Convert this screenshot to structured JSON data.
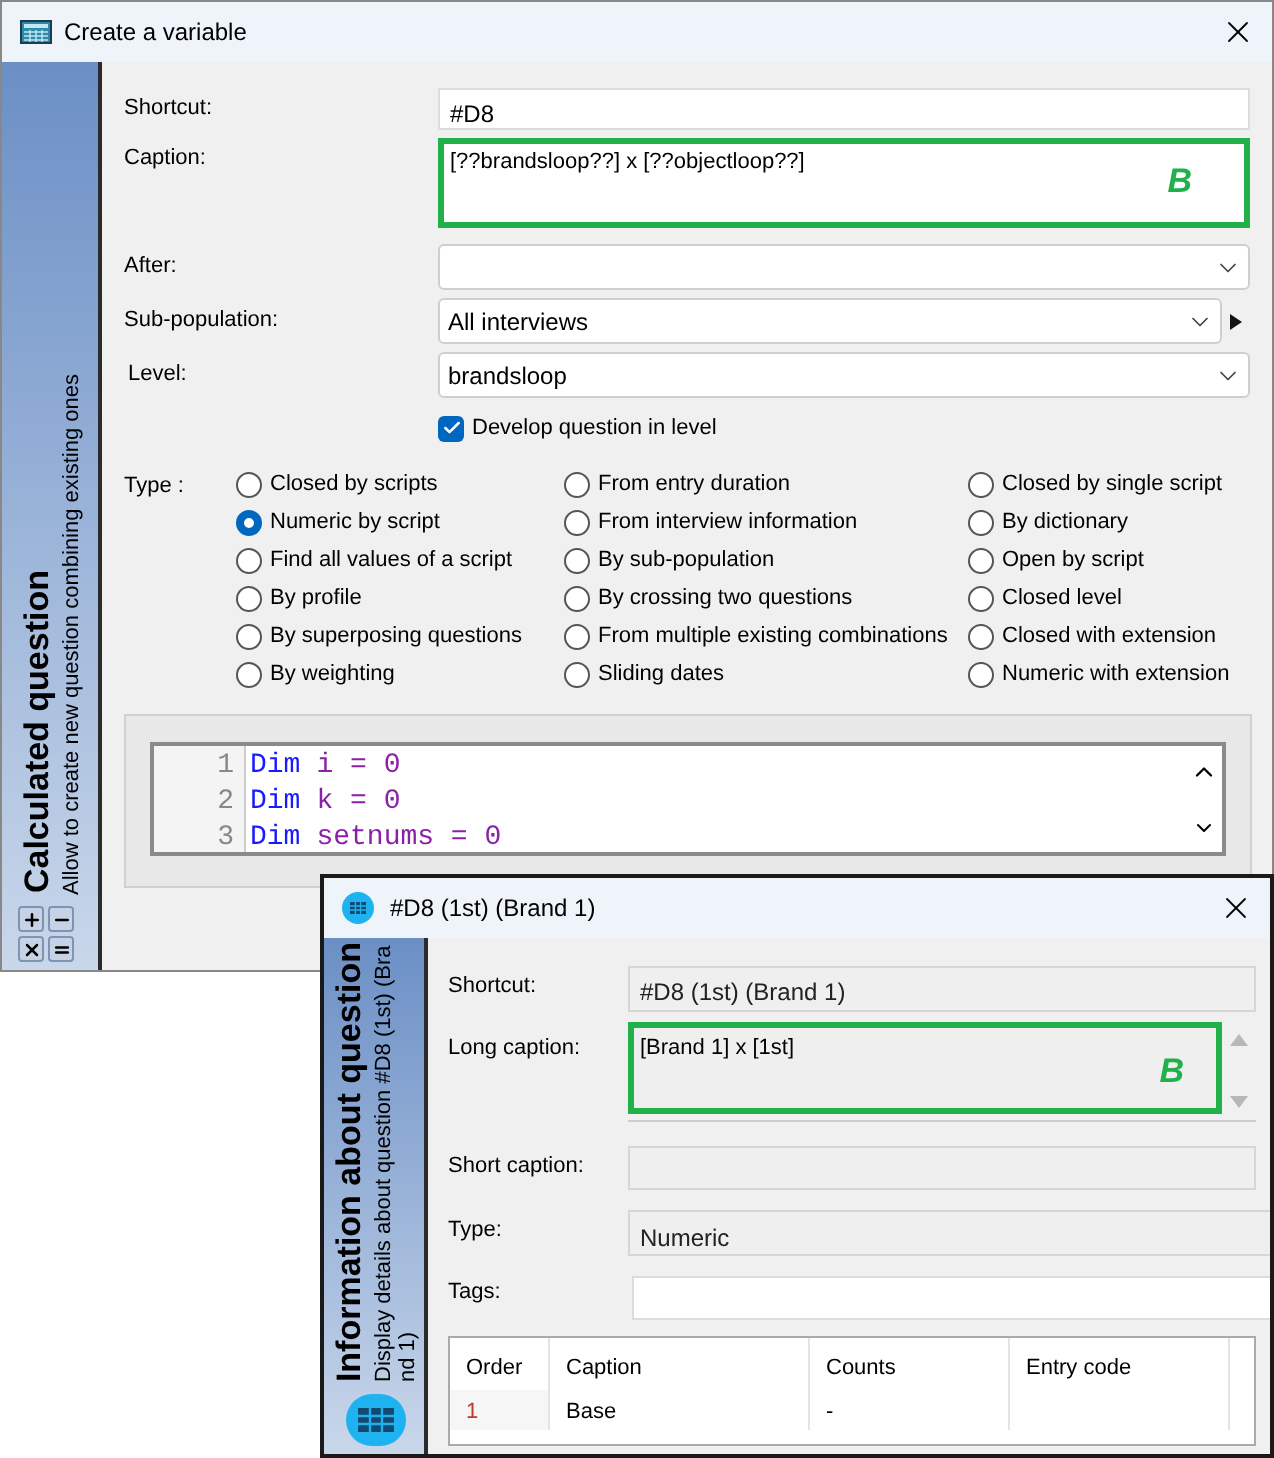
{
  "main_window": {
    "title": "Create a variable",
    "sidebar": {
      "title": "Calculated question",
      "subtitle": "Allow to create new question combining existing ones"
    },
    "form": {
      "shortcut": {
        "label": "Shortcut:",
        "value": "#D8"
      },
      "caption": {
        "label": "Caption:",
        "value": "[??brandsloop??] x [??objectloop??]",
        "annotation": "B"
      },
      "after": {
        "label": "After:"
      },
      "sub_population": {
        "label": "Sub-population:",
        "value": "All interviews"
      },
      "level": {
        "label": "Level:",
        "value": "brandsloop"
      },
      "develop": {
        "label": "Develop question in level",
        "checked": true
      }
    },
    "type": {
      "label": "Type :",
      "columns": [
        [
          {
            "label": "Closed by scripts",
            "selected": false
          },
          {
            "label": "Numeric by script",
            "selected": true
          },
          {
            "label": "Find all values of a script",
            "selected": false
          },
          {
            "label": "By profile",
            "selected": false
          },
          {
            "label": "By superposing questions",
            "selected": false
          },
          {
            "label": "By weighting",
            "selected": false
          }
        ],
        [
          {
            "label": "From entry duration",
            "selected": false
          },
          {
            "label": "From interview information",
            "selected": false
          },
          {
            "label": "By sub-population",
            "selected": false
          },
          {
            "label": "By crossing two questions",
            "selected": false
          },
          {
            "label": "From multiple existing combinations",
            "selected": false
          },
          {
            "label": "Sliding dates",
            "selected": false
          }
        ],
        [
          {
            "label": "Closed by single script",
            "selected": false
          },
          {
            "label": "By dictionary",
            "selected": false
          },
          {
            "label": "Open by script",
            "selected": false
          },
          {
            "label": "Closed level",
            "selected": false
          },
          {
            "label": "Closed with extension",
            "selected": false
          },
          {
            "label": "Numeric with extension",
            "selected": false
          }
        ]
      ]
    },
    "code": [
      {
        "number": "1",
        "tokens": [
          {
            "kind": "keyword",
            "text": "Dim"
          },
          {
            "kind": "plain",
            "text": "i = 0"
          }
        ]
      },
      {
        "number": "2",
        "tokens": [
          {
            "kind": "keyword",
            "text": "Dim"
          },
          {
            "kind": "plain",
            "text": "k = 0"
          }
        ]
      },
      {
        "number": "3",
        "tokens": [
          {
            "kind": "keyword",
            "text": "Dim"
          },
          {
            "kind": "plain",
            "text": "setnums = 0"
          }
        ]
      }
    ]
  },
  "info_window": {
    "title": "#D8 (1st) (Brand 1)",
    "sidebar": {
      "title": "Information about question",
      "subtitle": "Display details about question #D8 (1st) (Brand 1)"
    },
    "form": {
      "shortcut": {
        "label": "Shortcut:",
        "value": "#D8 (1st) (Brand 1)"
      },
      "long_caption": {
        "label": "Long caption:",
        "value": "[Brand 1] x [1st]",
        "annotation": "B"
      },
      "short_caption": {
        "label": "Short caption:"
      },
      "type": {
        "label": "Type:",
        "value": "Numeric"
      },
      "tags": {
        "label": "Tags:"
      }
    },
    "table": {
      "columns": [
        "Order",
        "Caption",
        "Counts",
        "Entry code"
      ],
      "rows": [
        [
          "1",
          "Base",
          "-"
        ]
      ]
    }
  }
}
